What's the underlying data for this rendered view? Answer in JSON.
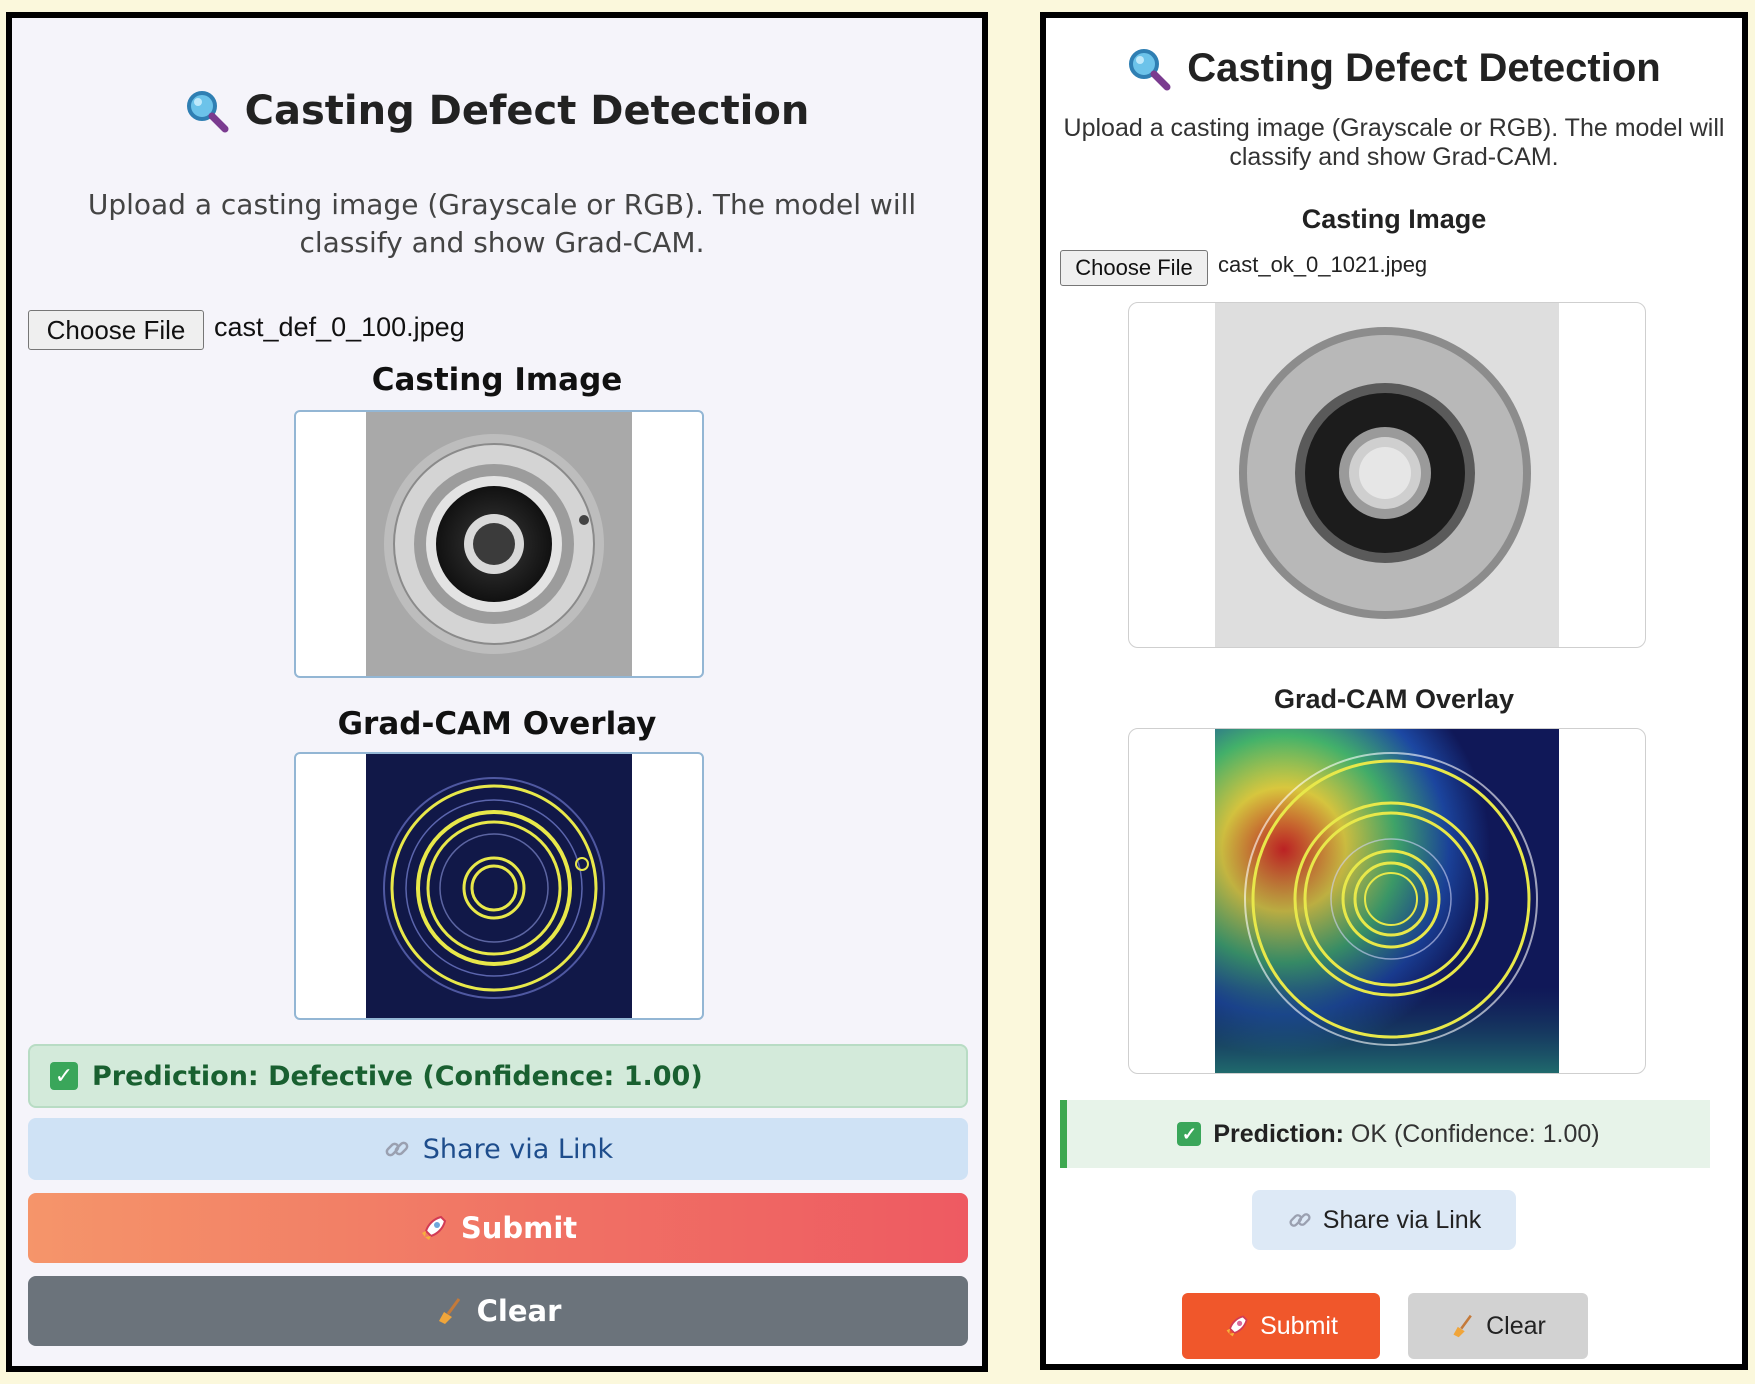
{
  "left_app": {
    "title": "Casting Defect Detection",
    "description": "Upload a casting image (Grayscale or RGB). The model will classify and show Grad-CAM.",
    "file_button": "Choose File",
    "file_name": "cast_def_0_100.jpeg",
    "input_image_label": "Casting Image",
    "overlay_label": "Grad-CAM Overlay",
    "prediction": "Prediction: Defective (Confidence: 1.00)",
    "share_button": "Share via Link",
    "submit_button": "Submit",
    "clear_button": "Clear",
    "colors": {
      "prediction_bg": "#d3eada",
      "share_bg": "#cfe2f5",
      "submit_gradient": [
        "#f5956a",
        "#ee5a62"
      ],
      "clear_bg": "#6b737b"
    }
  },
  "right_app": {
    "title": "Casting Defect Detection",
    "description": "Upload a casting image (Grayscale or RGB). The model will classify and show Grad-CAM.",
    "input_image_label": "Casting Image",
    "file_button": "Choose File",
    "file_name": "cast_ok_0_1021.jpeg",
    "overlay_label": "Grad-CAM Overlay",
    "prediction_label": "Prediction:",
    "prediction_value": "OK (Confidence: 1.00)",
    "share_button": "Share via Link",
    "submit_button": "Submit",
    "clear_button": "Clear",
    "colors": {
      "prediction_bg": "#e7f3e9",
      "prediction_accent": "#3da84f",
      "submit_bg": "#f0572b",
      "clear_bg": "#d2d2d2"
    }
  },
  "icons": [
    "magnifier-icon",
    "checkbox-icon",
    "link-icon",
    "rocket-icon",
    "broom-icon"
  ]
}
